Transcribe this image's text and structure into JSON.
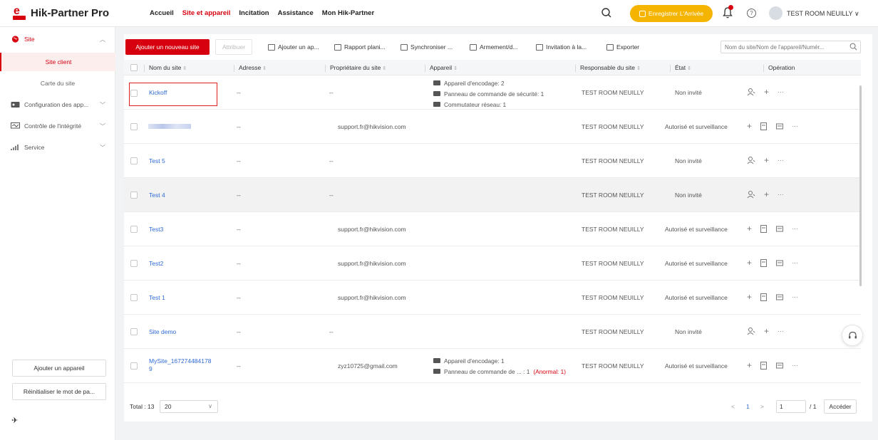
{
  "app": {
    "name": "Hik-Partner Pro",
    "brand_color": "#d7000f"
  },
  "nav": [
    {
      "label": "Accueil",
      "active": false
    },
    {
      "label": "Site et appareil",
      "active": true
    },
    {
      "label": "Incitation",
      "active": false
    },
    {
      "label": "Assistance",
      "active": false
    },
    {
      "label": "Mon Hik-Partner",
      "active": false
    }
  ],
  "header": {
    "register_label": "Enregistrer L'Arrivée",
    "help_glyph": "?",
    "user_name": "TEST ROOM NEUILLY ∨"
  },
  "sidebar": {
    "group_site": "Site",
    "sub_items": [
      "Site client",
      "Carte du site"
    ],
    "groups": [
      "Configuration des app...",
      "Contrôle de l'intégrité",
      "Service"
    ],
    "add_device_label": "Ajouter un appareil",
    "reset_password_label": "Réinitialiser le mot de pa...",
    "pin_glyph": "✈"
  },
  "toolbar": {
    "add_site_label": "Ajouter un nouveau site",
    "assign_label": "Attribuer",
    "actions": [
      "Ajouter un ap...",
      "Rapport plani...",
      "Synchroniser ...",
      "Armement/d...",
      "Invitation à la...",
      "Exporter"
    ],
    "search_placeholder": "Nom du site/Nom de l'appareil/Numér..."
  },
  "table": {
    "columns": [
      "Nom du site",
      "Adresse",
      "Propriétaire du site",
      "Appareil",
      "Responsable du site",
      "État",
      "Opération"
    ],
    "sort_glyph": "⇕",
    "rows": [
      {
        "name": "Kickoff",
        "address": "--",
        "owner": "--",
        "devices": [
          "Appareil d'encodage: 2",
          "Panneau de commande de sécurité: 1",
          "Commutateur réseau: 1"
        ],
        "manager": "TEST ROOM NEUILLY",
        "status": "Non invité"
      },
      {
        "name": "",
        "address": "--",
        "owner": "support.fr@hikvision.com",
        "devices": [],
        "manager": "TEST ROOM NEUILLY",
        "status": "Autorisé et surveillance"
      },
      {
        "name": "Test 5",
        "address": "--",
        "owner": "--",
        "devices": [],
        "manager": "TEST ROOM NEUILLY",
        "status": "Non invité"
      },
      {
        "name": "Test 4",
        "address": "--",
        "owner": "--",
        "devices": [],
        "manager": "TEST ROOM NEUILLY",
        "status": "Non invité"
      },
      {
        "name": "Test3",
        "address": "--",
        "owner": "support.fr@hikvision.com",
        "devices": [],
        "manager": "TEST ROOM NEUILLY",
        "status": "Autorisé et surveillance"
      },
      {
        "name": "Test2",
        "address": "--",
        "owner": "support.fr@hikvision.com",
        "devices": [],
        "manager": "TEST ROOM NEUILLY",
        "status": "Autorisé et surveillance"
      },
      {
        "name": "Test 1",
        "address": "--",
        "owner": "support.fr@hikvision.com",
        "devices": [],
        "manager": "TEST ROOM NEUILLY",
        "status": "Autorisé et surveillance"
      },
      {
        "name": "Site demo",
        "address": "--",
        "owner": "--",
        "devices": [],
        "manager": "TEST ROOM NEUILLY",
        "status": "Non invité"
      },
      {
        "name_line1": "MySite_167274484178",
        "name_line2": "9",
        "address": "--",
        "owner": "zyz10725@gmail.com",
        "device1": "Appareil d'encodage: 1",
        "device2": "Panneau de commande de ... : 1",
        "device2_abnormal": "(Anormal: 1)",
        "manager": "TEST ROOM NEUILLY",
        "status": "Autorisé et surveillance"
      }
    ],
    "op_add": "+",
    "op_more": "···"
  },
  "footer": {
    "total_label": "Total : 13",
    "page_size": "20",
    "prev": "<",
    "current_page": "1",
    "next": ">",
    "page_input": "1",
    "page_total": "/ 1",
    "goto_label": "Accéder"
  }
}
